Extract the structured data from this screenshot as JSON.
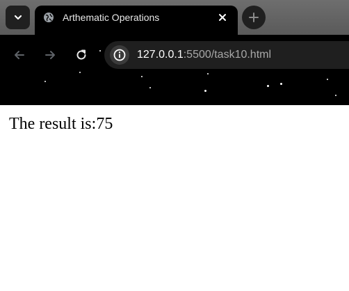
{
  "browser": {
    "tab": {
      "title": "Arthematic Operations"
    },
    "address_bar": {
      "host": "127.0.0.1",
      "path": ":5500/task10.html"
    },
    "icons": {
      "tab_search": "chevron-down-icon",
      "favicon": "globe-icon",
      "close_tab": "close-icon",
      "new_tab": "plus-icon",
      "back": "back-arrow-icon",
      "forward": "forward-arrow-icon",
      "reload": "reload-icon",
      "site_info": "info-icon"
    }
  },
  "page": {
    "result_label": "The result is:",
    "result_value": "75"
  }
}
